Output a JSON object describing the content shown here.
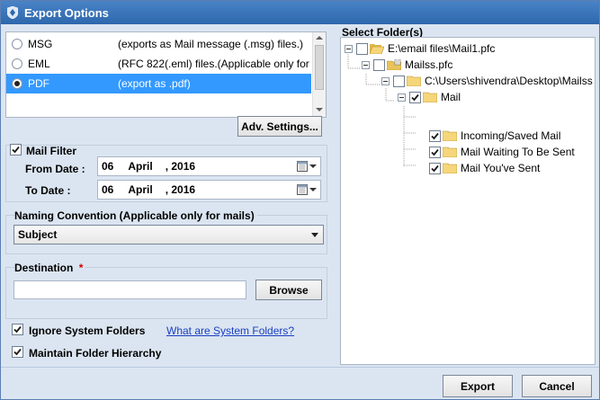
{
  "window": {
    "title": "Export Options"
  },
  "formats": [
    {
      "name": "MSG",
      "desc": "(exports as Mail message (.msg) files.)",
      "selected": false
    },
    {
      "name": "EML",
      "desc": "(RFC 822(.eml) files.(Applicable only for ...",
      "selected": false
    },
    {
      "name": "PDF",
      "desc": "(export as .pdf)",
      "selected": true
    }
  ],
  "adv_settings_label": "Adv. Settings...",
  "mail_filter": {
    "label": "Mail Filter",
    "checked": true,
    "from_label": "From Date :",
    "from": {
      "day": "06",
      "month": "April",
      "year": ", 2016"
    },
    "to_label": "To Date :",
    "to": {
      "day": "06",
      "month": "April",
      "year": ", 2016"
    }
  },
  "naming": {
    "label": "Naming Convention (Applicable only for mails)",
    "value": "Subject"
  },
  "destination": {
    "label": "Destination",
    "required_mark": "*",
    "value": "",
    "placeholder": "",
    "browse_label": "Browse"
  },
  "ignore_system": {
    "label": "Ignore System Folders",
    "checked": true
  },
  "system_link": "What are System Folders?",
  "maintain_hierarchy": {
    "label": "Maintain Folder Hierarchy",
    "checked": true
  },
  "select_folders": {
    "label": "Select Folder(s)",
    "tree": [
      {
        "label": "E:\\email files\\Mail1.pfc",
        "checked": false
      },
      {
        "label": "Mailss.pfc",
        "checked": false
      },
      {
        "label": "C:\\Users\\shivendra\\Desktop\\Mailss",
        "checked": false
      },
      {
        "label": "Mail",
        "checked": true
      },
      {
        "label": "Incoming/Saved Mail",
        "checked": true
      },
      {
        "label": "Mail Waiting To Be Sent",
        "checked": true
      },
      {
        "label": "Mail You've Sent",
        "checked": true
      }
    ]
  },
  "footer": {
    "export_label": "Export",
    "cancel_label": "Cancel"
  },
  "colors": {
    "title_bar": "#2d67ad",
    "selection": "#3399ff",
    "link": "#1a3fbf",
    "required": "#d40000"
  }
}
